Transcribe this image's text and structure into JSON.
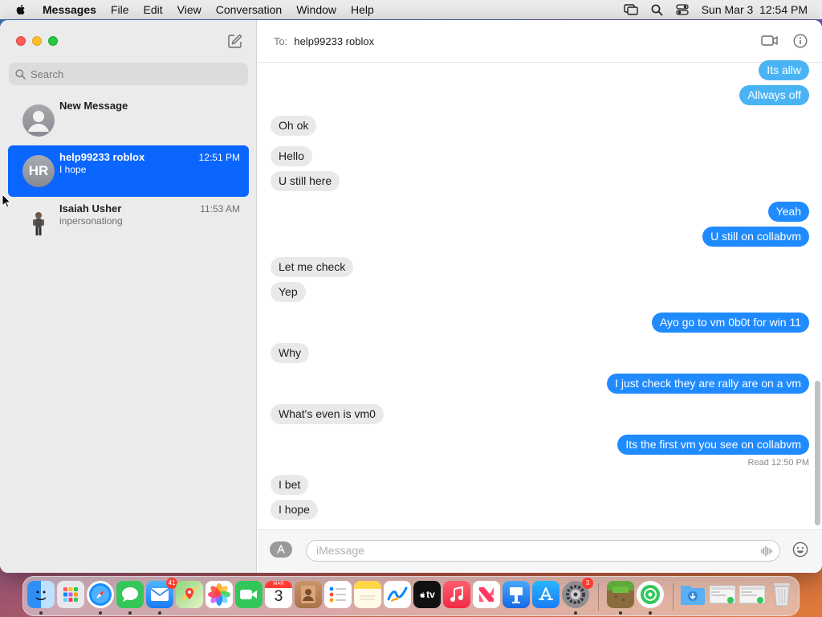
{
  "menubar": {
    "app_name": "Messages",
    "items": [
      "File",
      "Edit",
      "View",
      "Conversation",
      "Window",
      "Help"
    ],
    "clock": "Sun Mar 3  12:54 PM"
  },
  "sidebar": {
    "search_placeholder": "Search",
    "conversations": [
      {
        "name": "New Message",
        "preview": "",
        "time": ""
      },
      {
        "name": "help99233 roblox",
        "preview": "I hope",
        "time": "12:51 PM",
        "initials": "HR"
      },
      {
        "name": "Isaiah Usher",
        "preview": "inpersonationg",
        "time": "11:53 AM"
      }
    ]
  },
  "header": {
    "to_label": "To:",
    "recipient": "help99233 roblox"
  },
  "thread": {
    "messages": [
      {
        "text": "Its allw",
        "dir": "out"
      },
      {
        "text": "Allways off",
        "dir": "out"
      },
      {
        "text": "Oh ok",
        "dir": "in"
      },
      {
        "text": "Hello",
        "dir": "in"
      },
      {
        "text": "U still here",
        "dir": "in"
      },
      {
        "text": "Yeah",
        "dir": "out"
      },
      {
        "text": "U still on collabvm",
        "dir": "out"
      },
      {
        "text": "Let me check",
        "dir": "in"
      },
      {
        "text": "Yep",
        "dir": "in"
      },
      {
        "text": "Ayo go to vm 0b0t for win 11",
        "dir": "out"
      },
      {
        "text": "Why",
        "dir": "in"
      },
      {
        "text": "I just check they are rally are on a vm",
        "dir": "out"
      },
      {
        "text": "What's even is vm0",
        "dir": "in"
      },
      {
        "text": "Its the first vm you see on collabvm",
        "dir": "out"
      },
      {
        "text": "I bet",
        "dir": "in"
      },
      {
        "text": "I hope",
        "dir": "in"
      }
    ],
    "read_receipt_label": "Read",
    "read_receipt_time": "12:50 PM"
  },
  "input": {
    "placeholder": "iMessage"
  },
  "dock": {
    "calendar_month": "MAR",
    "calendar_day": "3",
    "mail_badge": "41",
    "settings_badge": "3",
    "tv_label": "tv",
    "apps": [
      "Finder",
      "Launchpad",
      "Safari",
      "Messages",
      "Mail",
      "Maps",
      "Photos",
      "FaceTime",
      "Calendar",
      "Contacts",
      "Reminders",
      "Notes",
      "Freeform",
      "TV",
      "Music",
      "News",
      "Keynote",
      "App Store",
      "System Settings",
      "Minecraft",
      "Find My",
      "Downloads",
      "Screenshot",
      "Screenshot",
      "Trash"
    ]
  },
  "colors": {
    "accent_blue": "#0a66ff",
    "bubble_outgoing": "#1f8bff",
    "bubble_outgoing_light": "#4ab3f4",
    "bubble_incoming": "#e9e9eb"
  }
}
